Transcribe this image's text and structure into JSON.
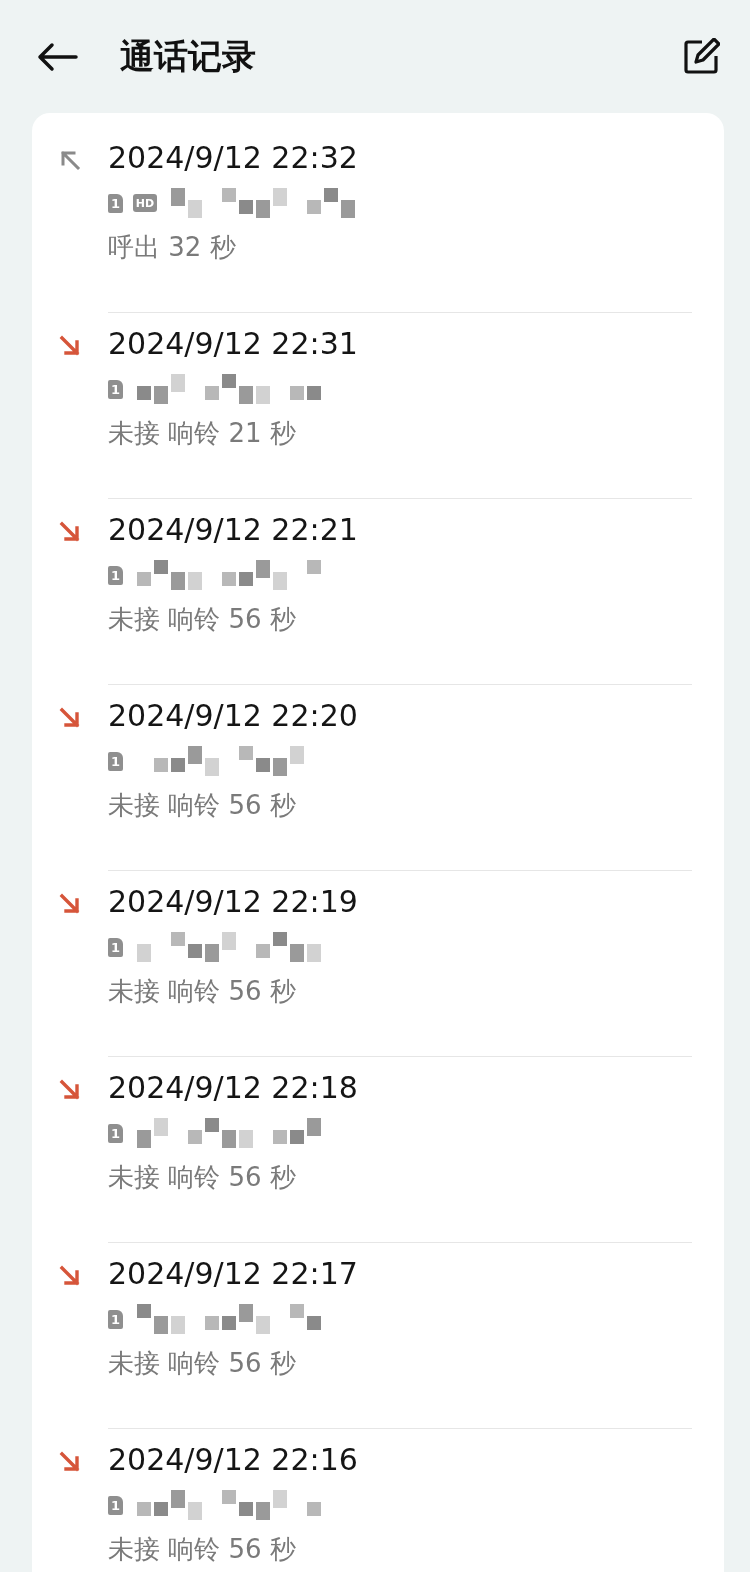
{
  "header": {
    "title": "通话记录"
  },
  "calls": [
    {
      "kind": "outgoing",
      "time": "2024/9/12 22:32",
      "sim": "1",
      "hd": "HD",
      "status": "呼出 32 秒"
    },
    {
      "kind": "missed",
      "time": "2024/9/12 22:31",
      "sim": "1",
      "status": "未接 响铃 21 秒"
    },
    {
      "kind": "missed",
      "time": "2024/9/12 22:21",
      "sim": "1",
      "status": "未接 响铃 56 秒"
    },
    {
      "kind": "missed",
      "time": "2024/9/12 22:20",
      "sim": "1",
      "status": "未接 响铃 56 秒"
    },
    {
      "kind": "missed",
      "time": "2024/9/12 22:19",
      "sim": "1",
      "status": "未接 响铃 56 秒"
    },
    {
      "kind": "missed",
      "time": "2024/9/12 22:18",
      "sim": "1",
      "status": "未接 响铃 56 秒"
    },
    {
      "kind": "missed",
      "time": "2024/9/12 22:17",
      "sim": "1",
      "status": "未接 响铃 56 秒"
    },
    {
      "kind": "missed",
      "time": "2024/9/12 22:16",
      "sim": "1",
      "status": "未接 响铃 56 秒"
    }
  ]
}
